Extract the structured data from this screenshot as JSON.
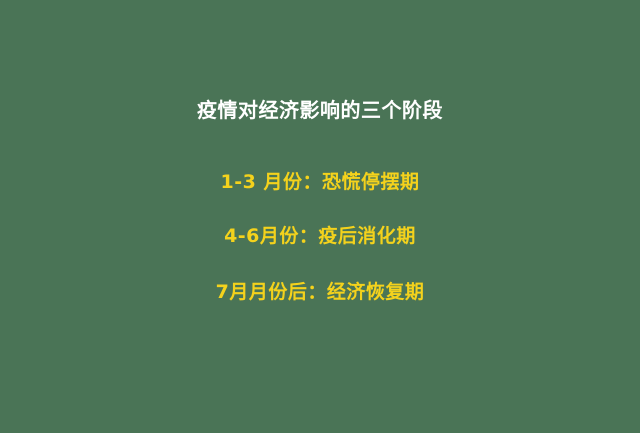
{
  "slide": {
    "title": "疫情对经济影响的三个阶段",
    "stages": [
      "1-3 月份：恐慌停摆期",
      "4-6月份：疫后消化期",
      "7月月份后：经济恢复期"
    ]
  },
  "colors": {
    "background": "#4a7456",
    "title": "#ffffff",
    "stage_text": "#f4d21c"
  }
}
